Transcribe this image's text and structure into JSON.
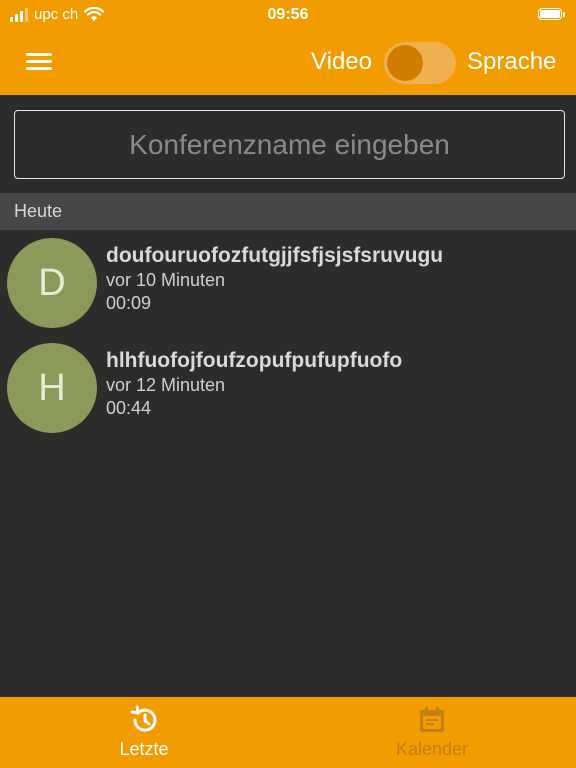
{
  "status_bar": {
    "carrier": "upc ch",
    "time": "09:56"
  },
  "header": {
    "menu_icon": "hamburger-menu-icon",
    "mode_left_label": "Video",
    "mode_right_label": "Sprache"
  },
  "search": {
    "placeholder": "Konferenzname eingeben",
    "value": ""
  },
  "section": {
    "title": "Heute"
  },
  "recent_calls": [
    {
      "initial": "D",
      "name": "doufouruofozfutgjjfsfjsjsfsruvugu",
      "when": "vor 10 Minuten",
      "duration": "00:09"
    },
    {
      "initial": "H",
      "name": "hlhfuofojfoufzopufpufupfuofo",
      "when": "vor 12 Minuten",
      "duration": "00:44"
    }
  ],
  "tabbar": {
    "tabs": [
      {
        "label": "Letzte",
        "icon": "history-icon",
        "active": true
      },
      {
        "label": "Kalender",
        "icon": "calendar-icon",
        "active": false
      }
    ]
  },
  "colors": {
    "accent": "#f39c00",
    "background": "#2c2c2b",
    "avatar": "#8b9a5b",
    "section_header": "#474747"
  }
}
